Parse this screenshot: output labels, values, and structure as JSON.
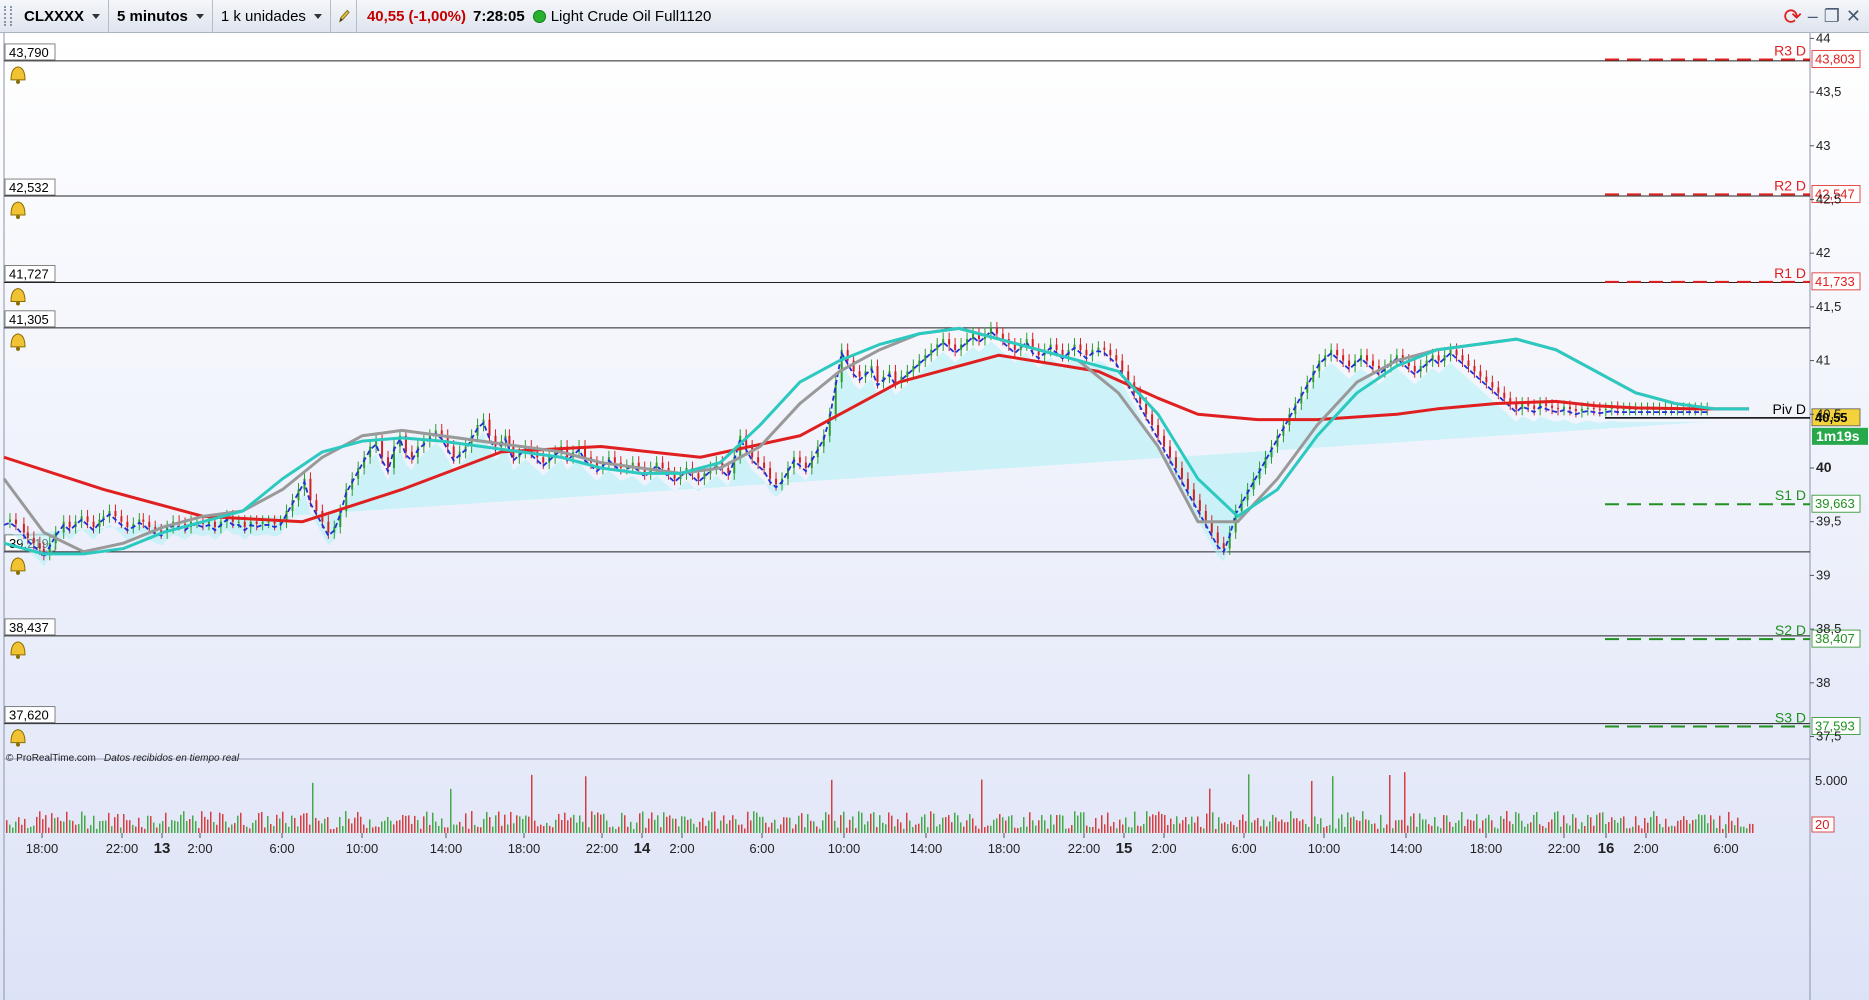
{
  "toolbar": {
    "symbol": "CLXXXX",
    "timeframe": "5 minutos",
    "units": "1 k unidades",
    "last_price": "40,55",
    "change": "(-1,00%)",
    "time": "7:28:05",
    "instrument": "Light Crude Oil Full1120",
    "status_color": "#27b22d"
  },
  "footer": {
    "copyright": "© ProRealTime.com",
    "feed": "Datos recibidos en tiempo real"
  },
  "chart_data": {
    "type": "line",
    "price_axis": {
      "ylim": [
        37.3,
        44.05
      ],
      "ticks": [
        [
          "44",
          44
        ],
        [
          "43,5",
          43.5
        ],
        [
          "43",
          43
        ],
        [
          "42,5",
          42.5
        ],
        [
          "42",
          42
        ],
        [
          "41,5",
          41.5
        ],
        [
          "41",
          41
        ],
        [
          "40,5",
          40.5
        ],
        [
          "40",
          40
        ],
        [
          "39,5",
          39.5
        ],
        [
          "39",
          39
        ],
        [
          "38,5",
          38.5
        ],
        [
          "38",
          38
        ],
        [
          "37,5",
          37.5
        ]
      ],
      "bold_ticks": [
        "40"
      ]
    },
    "x_ticks": [
      {
        "label": "18:00",
        "bold": false
      },
      {
        "label": "22:00",
        "bold": false
      },
      {
        "label": "13",
        "bold": true
      },
      {
        "label": "2:00",
        "bold": false
      },
      {
        "label": "6:00",
        "bold": false
      },
      {
        "label": "10:00",
        "bold": false
      },
      {
        "label": "14:00",
        "bold": false
      },
      {
        "label": "18:00",
        "bold": false
      },
      {
        "label": "22:00",
        "bold": false
      },
      {
        "label": "14",
        "bold": true
      },
      {
        "label": "2:00",
        "bold": false
      },
      {
        "label": "6:00",
        "bold": false
      },
      {
        "label": "10:00",
        "bold": false
      },
      {
        "label": "14:00",
        "bold": false
      },
      {
        "label": "18:00",
        "bold": false
      },
      {
        "label": "22:00",
        "bold": false
      },
      {
        "label": "15",
        "bold": true
      },
      {
        "label": "2:00",
        "bold": false
      },
      {
        "label": "6:00",
        "bold": false
      },
      {
        "label": "10:00",
        "bold": false
      },
      {
        "label": "14:00",
        "bold": false
      },
      {
        "label": "18:00",
        "bold": false
      },
      {
        "label": "22:00",
        "bold": false
      },
      {
        "label": "16",
        "bold": true
      },
      {
        "label": "2:00",
        "bold": false
      },
      {
        "label": "6:00",
        "bold": false
      }
    ],
    "horizontal_lines": [
      {
        "label": "43,790",
        "value": 43.79
      },
      {
        "label": "42,532",
        "value": 42.532
      },
      {
        "label": "41,727",
        "value": 41.727
      },
      {
        "label": "41,305",
        "value": 41.305
      },
      {
        "label": "39,219",
        "value": 39.219
      },
      {
        "label": "38,437",
        "value": 38.437
      },
      {
        "label": "37,620",
        "value": 37.62
      }
    ],
    "pivots": [
      {
        "name": "R3 D",
        "value": 43.803,
        "label": "43,803",
        "color": "#e02020"
      },
      {
        "name": "R2 D",
        "value": 42.547,
        "label": "42,547",
        "color": "#e02020"
      },
      {
        "name": "R1 D",
        "value": 41.733,
        "label": "41,733",
        "color": "#e02020"
      },
      {
        "name": "Piv D",
        "value": 40.467,
        "label": "40,55",
        "color": "#000000"
      },
      {
        "name": "S1 D",
        "value": 39.663,
        "label": "39,663",
        "color": "#209020"
      },
      {
        "name": "S2 D",
        "value": 38.407,
        "label": "38,407",
        "color": "#209020"
      },
      {
        "name": "S3 D",
        "value": 37.593,
        "label": "37,593",
        "color": "#209020"
      }
    ],
    "price_series": {
      "x": [
        0,
        0.3,
        0.6,
        1,
        1.2,
        1.5,
        1.8,
        2,
        2.3,
        2.6,
        3,
        3.3,
        3.6,
        3.9,
        4.2,
        4.5,
        4.8,
        5,
        5.3,
        5.6,
        5.9,
        6.2,
        6.5,
        6.8,
        7,
        7.3,
        7.6,
        7.9,
        8.2,
        8.5,
        8.8,
        9.1,
        9.4,
        9.7,
        10,
        10.3,
        10.6,
        10.9,
        11.2,
        11.5,
        11.8,
        12.1,
        12.4,
        12.7,
        13,
        13.3,
        13.6,
        13.9,
        14.2,
        14.5,
        14.8,
        15.1,
        15.4,
        15.7,
        16,
        16.3,
        16.6,
        16.9,
        17.2,
        17.5,
        17.8,
        18.1,
        18.4,
        18.7,
        19,
        19.3,
        19.6,
        19.9,
        20.2,
        20.5,
        20.8,
        21.1,
        21.4,
        21.7,
        22,
        22.3,
        22.6,
        22.9,
        23.2,
        23.5,
        23.8,
        24.1,
        24.4,
        24.7,
        25,
        25.2,
        25.4,
        25.6,
        25.9,
        26.2,
        26.5,
        26.8,
        27.1,
        27.4,
        27.7,
        28,
        28.3,
        28.6,
        28.9,
        29.2,
        29.5,
        29.8,
        30.1,
        30.4,
        30.7,
        31,
        31.3,
        31.6,
        31.9,
        32.2,
        32.5,
        32.8,
        33.1,
        33.4,
        33.7,
        34,
        34.3,
        34.6,
        34.9,
        35.2,
        35.5,
        35.8,
        36.1,
        36.4,
        36.7,
        37,
        37.3,
        37.6,
        37.9,
        38.2,
        38.5,
        38.8,
        39.1,
        39.4,
        39.7,
        40,
        40.3,
        40.6,
        40.9,
        41.2,
        41.5,
        41.8,
        42.1,
        42.4,
        42.7,
        43,
        43.3,
        43.6,
        43.9,
        44.2,
        44.5,
        44.8,
        45.1,
        45.4,
        45.7,
        46,
        46.3,
        46.6,
        46.9,
        47.2,
        47.5,
        47.8,
        48.1,
        48.4,
        48.7,
        49,
        49.3,
        49.6,
        49.9,
        50.2,
        50.5,
        50.8,
        51.1,
        51.4,
        51.7,
        52,
        52.3,
        52.6,
        52.9,
        53.2,
        53.5,
        53.8,
        54.1,
        54.4,
        54.7,
        55,
        55.3,
        55.6,
        55.9,
        56.2,
        56.5,
        56.8,
        57.1,
        57.4,
        57.7,
        58,
        58.3,
        58.6,
        58.9,
        59.2,
        59.5,
        59.8,
        60.1,
        60.4,
        60.7,
        61,
        61.3,
        61.6,
        61.9,
        62.2,
        62.5,
        62.8,
        63.1,
        63.4,
        63.7,
        64,
        64.3,
        64.6,
        64.9,
        65.2,
        65.5,
        65.8,
        66.1,
        66.4,
        66.7,
        67,
        67.3,
        67.6,
        67.9,
        68.2,
        68.5,
        68.8,
        69.1,
        69.4,
        69.7,
        70,
        70.3,
        70.6,
        70.9,
        71.2,
        71.5,
        71.8,
        72.1,
        72.4,
        72.7,
        73,
        73.3,
        73.6,
        73.9,
        74.2,
        74.5,
        74.8,
        75.1,
        75.4,
        75.7,
        76,
        76.3,
        76.6,
        76.9,
        77.2,
        77.5,
        77.8,
        78.1,
        78.4,
        78.7,
        79,
        79.3,
        79.6,
        79.9,
        80.2,
        80.5,
        80.8,
        81.1,
        81.4,
        81.7,
        82,
        82.3,
        82.6,
        82.9,
        83.2,
        83.5,
        83.8,
        84.1,
        84.4,
        84.7,
        85,
        85.3,
        85.6,
        85.9,
        86.2,
        86.5,
        86.8,
        87.1,
        87.4,
        87.7
      ],
      "y": [
        39.5,
        39.52,
        39.48,
        39.4,
        39.35,
        39.3,
        39.25,
        39.2,
        39.3,
        39.4,
        39.5,
        39.45,
        39.5,
        39.55,
        39.5,
        39.45,
        39.52,
        39.55,
        39.6,
        39.55,
        39.5,
        39.45,
        39.48,
        39.52,
        39.5,
        39.45,
        39.42,
        39.4,
        39.45,
        39.5,
        39.48,
        39.45,
        39.5,
        39.5,
        39.48,
        39.5,
        39.45,
        39.5,
        39.55,
        39.5,
        39.5,
        39.45,
        39.5,
        39.48,
        39.5,
        39.5,
        39.48,
        39.5,
        39.6,
        39.7,
        39.8,
        39.9,
        39.7,
        39.6,
        39.5,
        39.4,
        39.45,
        39.6,
        39.8,
        39.9,
        40,
        40.1,
        40.2,
        40.25,
        40.1,
        40.0,
        40.2,
        40.3,
        40.15,
        40.1,
        40.2,
        40.25,
        40.3,
        40.35,
        40.3,
        40.2,
        40.1,
        40.15,
        40.2,
        40.3,
        40.4,
        40.45,
        40.3,
        40.2,
        40.25,
        40.3,
        40.2,
        40.1,
        40.15,
        40.2,
        40.15,
        40.1,
        40.05,
        40.1,
        40.15,
        40.2,
        40.1,
        40.15,
        40.2,
        40.1,
        40.05,
        40.0,
        40.05,
        40.1,
        40.05,
        40.0,
        40.02,
        40.05,
        40.0,
        39.95,
        40.0,
        40.05,
        40.0,
        39.95,
        39.9,
        39.95,
        40.0,
        39.95,
        39.9,
        39.95,
        40.0,
        40.05,
        40.0,
        39.95,
        40.1,
        40.3,
        40.2,
        40.1,
        40.05,
        40.0,
        39.9,
        39.85,
        39.9,
        40.0,
        40.1,
        40.05,
        40.0,
        40.1,
        40.2,
        40.3,
        40.5,
        40.8,
        41.1,
        41.0,
        40.9,
        40.85,
        40.9,
        40.95,
        40.8,
        40.85,
        40.9,
        40.8,
        40.85,
        40.9,
        40.95,
        41.0,
        41.05,
        41.1,
        41.15,
        41.2,
        41.15,
        41.1,
        41.15,
        41.2,
        41.25,
        41.2,
        41.25,
        41.3,
        41.25,
        41.2,
        41.15,
        41.1,
        41.15,
        41.2,
        41.1,
        41.05,
        41.1,
        41.15,
        41.1,
        41.05,
        41.1,
        41.15,
        41.1,
        41.05,
        41.1,
        41.12,
        41.1,
        41.05,
        41.0,
        40.9,
        40.8,
        40.7,
        40.6,
        40.5,
        40.4,
        40.3,
        40.2,
        40.1,
        40.0,
        39.9,
        39.8,
        39.7,
        39.6,
        39.5,
        39.4,
        39.3,
        39.25,
        39.4,
        39.6,
        39.7,
        39.8,
        39.9,
        40.0,
        40.1,
        40.2,
        40.3,
        40.4,
        40.5,
        40.6,
        40.7,
        40.8,
        40.9,
        41.0,
        41.05,
        41.1,
        41.05,
        41.0,
        40.95,
        41.0,
        41.05,
        41.0,
        40.95,
        40.9,
        40.95,
        41.0,
        41.05,
        41.0,
        40.95,
        40.9,
        40.95,
        41.0,
        41.05,
        41.0,
        41.05,
        41.1,
        41.05,
        41.0,
        40.95,
        40.9,
        40.85,
        40.8,
        40.75,
        40.7,
        40.65,
        40.6,
        40.55,
        40.6,
        40.58,
        40.55,
        40.6,
        40.58,
        40.56,
        40.55,
        40.57,
        40.55,
        40.53,
        40.55,
        40.56,
        40.55,
        40.54,
        40.55,
        40.56,
        40.55,
        40.55,
        40.55,
        40.55,
        40.55,
        40.55,
        40.55,
        40.55,
        40.55,
        40.55,
        40.55,
        40.55,
        40.55,
        40.55,
        40.55,
        40.55
      ]
    },
    "moving_averages": [
      {
        "color": "#e02020",
        "x": [
          0,
          5,
          10,
          15,
          20,
          25,
          30,
          35,
          40,
          45,
          50,
          55,
          58,
          60,
          63,
          66,
          70,
          72,
          75,
          78,
          80,
          82,
          85,
          87.7
        ],
        "y": [
          40.1,
          39.8,
          39.55,
          39.5,
          39.8,
          40.15,
          40.2,
          40.1,
          40.3,
          40.8,
          41.05,
          40.9,
          40.65,
          40.5,
          40.45,
          40.45,
          40.5,
          40.55,
          40.6,
          40.62,
          40.58,
          40.56,
          40.55,
          40.55
        ]
      },
      {
        "color": "#999999",
        "x": [
          0,
          2,
          4,
          6,
          8,
          10,
          12,
          14,
          16,
          18,
          20,
          22,
          24,
          26,
          28,
          30,
          32,
          34,
          36,
          38,
          40,
          42,
          44,
          46,
          48,
          50,
          52,
          54,
          56,
          58,
          60,
          62,
          64,
          66,
          68,
          70,
          72,
          74,
          76,
          78,
          80,
          82,
          84,
          86,
          87.7
        ],
        "y": [
          39.9,
          39.4,
          39.22,
          39.3,
          39.45,
          39.55,
          39.6,
          39.8,
          40.1,
          40.3,
          40.35,
          40.3,
          40.25,
          40.2,
          40.15,
          40.05,
          40.0,
          39.95,
          40.0,
          40.2,
          40.6,
          40.9,
          41.1,
          41.25,
          41.3,
          41.2,
          41.1,
          41.0,
          40.7,
          40.2,
          39.5,
          39.5,
          39.9,
          40.4,
          40.8,
          41.0,
          41.1,
          41.15,
          41.2,
          41.1,
          40.9,
          40.7,
          40.6,
          40.55,
          40.55
        ]
      },
      {
        "color": "#2cc9c0",
        "x": [
          0,
          2,
          4,
          6,
          8,
          10,
          12,
          14,
          16,
          18,
          20,
          22,
          24,
          26,
          28,
          30,
          32,
          34,
          36,
          38,
          40,
          42,
          44,
          46,
          48,
          50,
          52,
          54,
          56,
          58,
          60,
          62,
          64,
          66,
          68,
          70,
          72,
          74,
          76,
          78,
          80,
          82,
          84,
          86,
          87.7
        ],
        "y": [
          39.3,
          39.2,
          39.2,
          39.25,
          39.4,
          39.5,
          39.6,
          39.9,
          40.15,
          40.25,
          40.28,
          40.25,
          40.2,
          40.15,
          40.1,
          40.0,
          39.95,
          39.95,
          40.05,
          40.4,
          40.8,
          41.0,
          41.15,
          41.25,
          41.3,
          41.2,
          41.1,
          41.0,
          40.9,
          40.5,
          39.9,
          39.55,
          39.8,
          40.3,
          40.7,
          40.95,
          41.1,
          41.15,
          41.2,
          41.1,
          40.9,
          40.7,
          40.6,
          40.55,
          40.55
        ]
      }
    ],
    "volume_axis": {
      "labels": [
        "5.000",
        "20"
      ]
    }
  }
}
